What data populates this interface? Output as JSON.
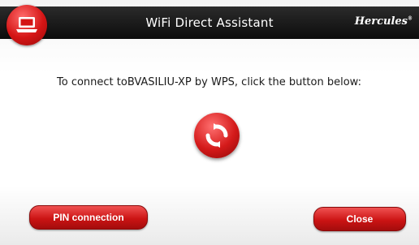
{
  "window": {
    "title": "WiFi Direct Assistant",
    "brand": "Hercules",
    "brand_mark": "®"
  },
  "icons": {
    "app": "laptop-icon",
    "wps": "wps-refresh-icon"
  },
  "message": "To connect toBVASILIU-XP by WPS, click the button below:",
  "buttons": {
    "pin": "PIN connection",
    "close": "Close"
  },
  "colors": {
    "accent": "#d41515",
    "titlebar": "#111111"
  }
}
